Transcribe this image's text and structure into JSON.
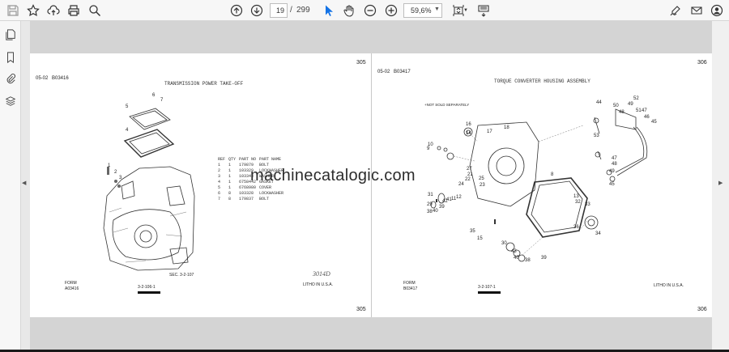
{
  "toolbar": {
    "current_page": "19",
    "page_separator": "/",
    "total_pages": "299",
    "zoom": "59,6%"
  },
  "left_page": {
    "page_number_top": "305",
    "page_number_bottom": "305",
    "header": "05-02",
    "doc_code": "B03416",
    "title": "TRANSMISSION POWER TAKE-OFF",
    "form_label": "FORM",
    "form_code": "A03416",
    "ref_label": "SEC. 3-2-107",
    "footer_code": "3-2-106-1",
    "litho": "LITHO IN U.S.A.",
    "handwritten": "3014D",
    "table": {
      "headers": [
        "REF",
        "QTY",
        "PART NO",
        "PART NAME"
      ],
      "rows": [
        [
          "1",
          "1",
          "179879",
          "BOLT"
        ],
        [
          "2",
          "1",
          "103329",
          "LOCKWASHER"
        ],
        [
          "3",
          "1",
          "103343",
          "WASHER"
        ],
        [
          "4",
          "1",
          "6758442",
          "GASKET"
        ],
        [
          "5",
          "1",
          "6768980",
          "COVER"
        ],
        [
          "6",
          "8",
          "103328",
          "LOCKWASHER"
        ],
        [
          "7",
          "8",
          "179837",
          "BOLT"
        ]
      ]
    },
    "callouts": [
      "5",
      "6",
      "7",
      "4",
      "1",
      "2",
      "3"
    ]
  },
  "right_page": {
    "page_number_top": "306",
    "page_number_bottom": "306",
    "header": "05-02",
    "doc_code": "B03417",
    "title": "TORQUE CONVERTER HOUSING ASSEMBLY",
    "note": "+NOT SOLD SEPARATELY",
    "form_label": "FORM",
    "form_code": "B03417",
    "footer_code": "3-2-107-1",
    "litho": "LITHO IN U.S.A.",
    "callouts": [
      "44",
      "52",
      "50",
      "49",
      "51",
      "47",
      "48",
      "46",
      "45",
      "53",
      "47",
      "48",
      "49",
      "45",
      "18",
      "17",
      "16",
      "14",
      "27",
      "21",
      "22",
      "25",
      "23",
      "24",
      "10",
      "9",
      "8",
      "31",
      "29",
      "40",
      "38",
      "39",
      "42",
      "41",
      "11",
      "12",
      "13",
      "32",
      "33",
      "34",
      "36",
      "35",
      "15",
      "30",
      "43",
      "40",
      "38",
      "39",
      "37",
      "28",
      "19",
      "21",
      "22"
    ]
  },
  "watermark": "machinecatalogic.com"
}
